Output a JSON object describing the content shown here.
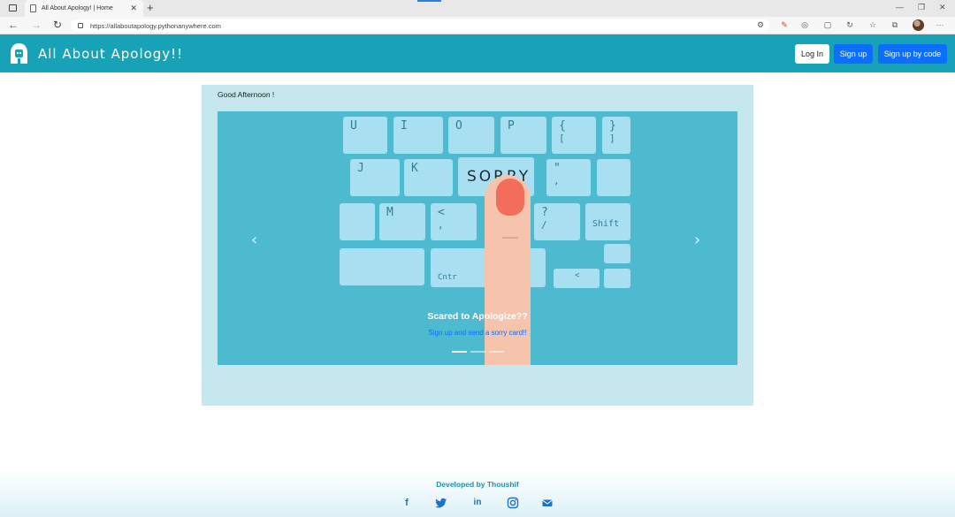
{
  "browser": {
    "tab_title": "All About Apology! | Home",
    "tab_close": "✕",
    "new_tab": "+",
    "url": "https://allaboutapology.pythonanywhere.com",
    "menu_dots": "···"
  },
  "navbar": {
    "brand": "All About Apology!!",
    "login_label": "Log In",
    "signup_label": "Sign up",
    "signup_code_label": "Sign up by code"
  },
  "main": {
    "greeting": "Good Afternoon !",
    "prev_arrow": "‹",
    "next_arrow": "›",
    "slide": {
      "keyboard_word": "SORRY",
      "keys": {
        "u": "U",
        "i": "I",
        "o": "O",
        "p": "P",
        "brace_upper": "{",
        "brace_lower": "[",
        "bracket_close_upper": "}",
        "bracket_close_lower": "]",
        "j": "J",
        "k": "K",
        "quote_upper": "\"",
        "quote_lower": ",",
        "m": "M",
        "lt": "<",
        "comma": ",",
        "question": "?",
        "slash": "/",
        "shift": "Shift",
        "ctrl": "Cntr",
        "left": "<"
      },
      "caption_title": "Scared to Apologize??",
      "caption_link": "Sign up and send a sorry card!!"
    },
    "slide_count": 3,
    "active_slide": 1
  },
  "footer": {
    "credit": "Developed by Thoushif",
    "social_icons": [
      "facebook-icon",
      "twitter-icon",
      "linkedin-icon",
      "instagram-icon",
      "envelope-icon"
    ]
  },
  "colors": {
    "navbar": "#17a2b8",
    "primary_button": "#0d6efd",
    "card_background": "#c7e7ee",
    "carousel_background": "#4dbad0"
  }
}
